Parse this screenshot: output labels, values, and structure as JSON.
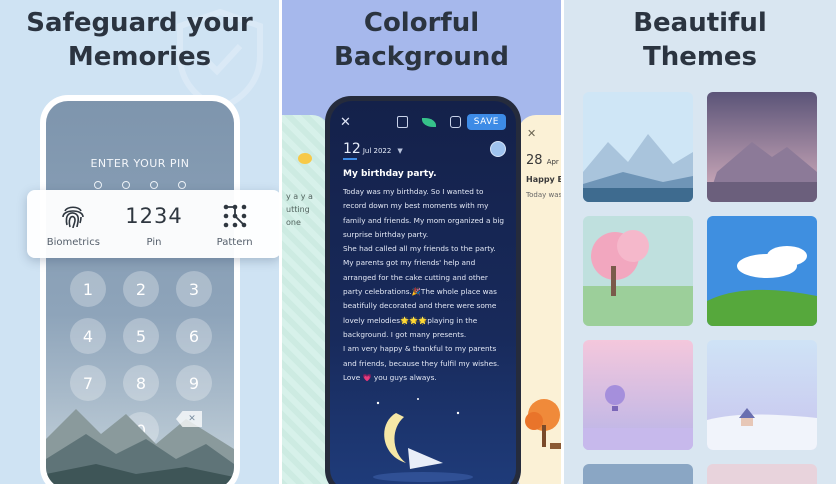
{
  "panels": {
    "security": {
      "title_line1": "Safeguard your",
      "title_line2": "Memories",
      "pin_prompt": "ENTER YOUR PIN",
      "keys": [
        "1",
        "2",
        "3",
        "4",
        "5",
        "6",
        "7",
        "8",
        "9",
        "",
        "0"
      ],
      "auth_options": [
        {
          "label": "Biometrics",
          "icon": "fingerprint-icon"
        },
        {
          "label": "Pin",
          "display": "1234"
        },
        {
          "label": "Pattern",
          "icon": "pattern-icon"
        }
      ]
    },
    "background": {
      "title_line1": "Colorful",
      "title_line2": "Background",
      "save_label": "SAVE",
      "date_day": "12",
      "date_month_year": "Jul 2022",
      "entry_title": "My birthday party.",
      "entry_paragraphs": [
        "Today was my birthday. So I wanted to record down my best moments with my family and friends. My mom organized a big surprise birthday party.",
        "She had called all my friends to the party. My parents got my friends' help and arranged for the cake cutting and other party celebrations.🎉The whole place was beatifully decorated and there were some lovely melodies🌟🌟🌟playing in the background. I got many presents.",
        "I am very happy & thankful to my parents and friends, because they fulfil my wishes. Love 💗 you guys always."
      ],
      "left_card_lines": [
        "y a y a",
        "utting",
        "one"
      ],
      "right_card": {
        "date_day": "28",
        "date_month": "Apr 2",
        "title": "Happy Bi",
        "snippet": "Today was"
      }
    },
    "themes": {
      "title_line1": "Beautiful",
      "title_line2": "Themes"
    }
  },
  "colors": {
    "save_button": "#3d8be6",
    "diary_bg": "#182a5b",
    "title_text": "#2b3440"
  }
}
